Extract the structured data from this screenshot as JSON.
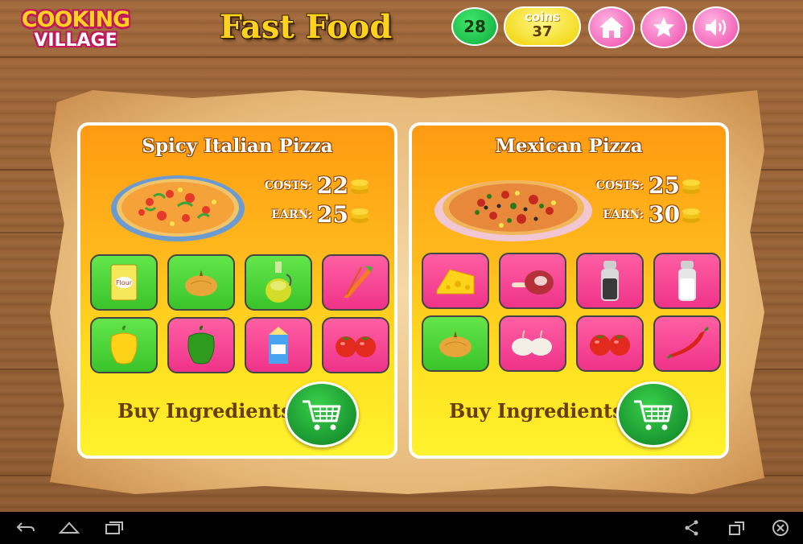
{
  "logo": {
    "line1": "COOKING",
    "line2": "VILLAGE"
  },
  "header": {
    "title": "Fast Food",
    "level": "28",
    "coins_label": "coins",
    "coins_value": "37",
    "buttons": [
      "home-icon",
      "star-icon",
      "sound-icon"
    ]
  },
  "recipes": [
    {
      "name": "Spicy Italian Pizza",
      "costs_label": "COSTS:",
      "costs": "22",
      "earn_label": "EARN:",
      "earn": "25",
      "ingredients": [
        {
          "icon": "flour-icon",
          "state": "green",
          "text": "Flour"
        },
        {
          "icon": "onion-icon",
          "state": "green"
        },
        {
          "icon": "olive-oil-icon",
          "state": "green"
        },
        {
          "icon": "carrot-icon",
          "state": "pink"
        },
        {
          "icon": "yellow-pepper-icon",
          "state": "green"
        },
        {
          "icon": "green-pepper-icon",
          "state": "pink"
        },
        {
          "icon": "milk-icon",
          "state": "pink"
        },
        {
          "icon": "tomatoes-icon",
          "state": "pink"
        }
      ],
      "buy_label": "Buy Ingredients"
    },
    {
      "name": "Mexican Pizza",
      "costs_label": "COSTS:",
      "costs": "25",
      "earn_label": "EARN:",
      "earn": "30",
      "ingredients": [
        {
          "icon": "cheese-icon",
          "state": "pink"
        },
        {
          "icon": "ham-icon",
          "state": "pink"
        },
        {
          "icon": "pepper-shaker-icon",
          "state": "pink"
        },
        {
          "icon": "salt-shaker-icon",
          "state": "pink"
        },
        {
          "icon": "onion-icon",
          "state": "green"
        },
        {
          "icon": "garlic-icon",
          "state": "pink"
        },
        {
          "icon": "tomatoes-icon",
          "state": "pink"
        },
        {
          "icon": "chili-icon",
          "state": "pink"
        }
      ],
      "buy_label": "Buy Ingredients"
    }
  ],
  "colors": {
    "tile_green": "#4fd63a",
    "tile_pink": "#f73f93",
    "card_top": "#ff9a12",
    "card_bottom": "#fff22e",
    "button_pink": "#f25cb5"
  },
  "system_nav": [
    "back-icon",
    "home-icon",
    "recent-apps-icon",
    "share-icon",
    "window-icon",
    "close-icon"
  ]
}
